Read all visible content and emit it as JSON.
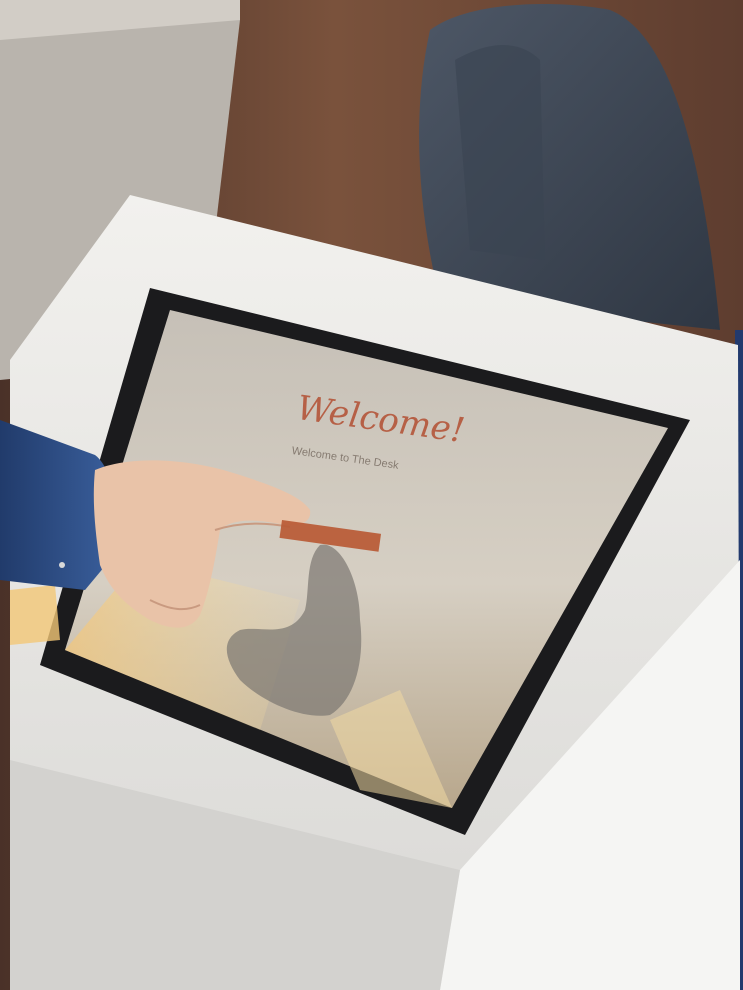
{
  "kiosk": {
    "welcome_title": "Welcome!",
    "welcome_subtitle": "Welcome to The Desk",
    "start_button_label": ""
  },
  "colors": {
    "wall": "#6b4a3a",
    "kiosk_body": "#ecebe8",
    "screen_bezel": "#1b1b1d",
    "screen_bg": "#cfc9c0",
    "accent": "#b85a35",
    "sleeve": "#2e4d85",
    "skin": "#e9c3a8"
  }
}
